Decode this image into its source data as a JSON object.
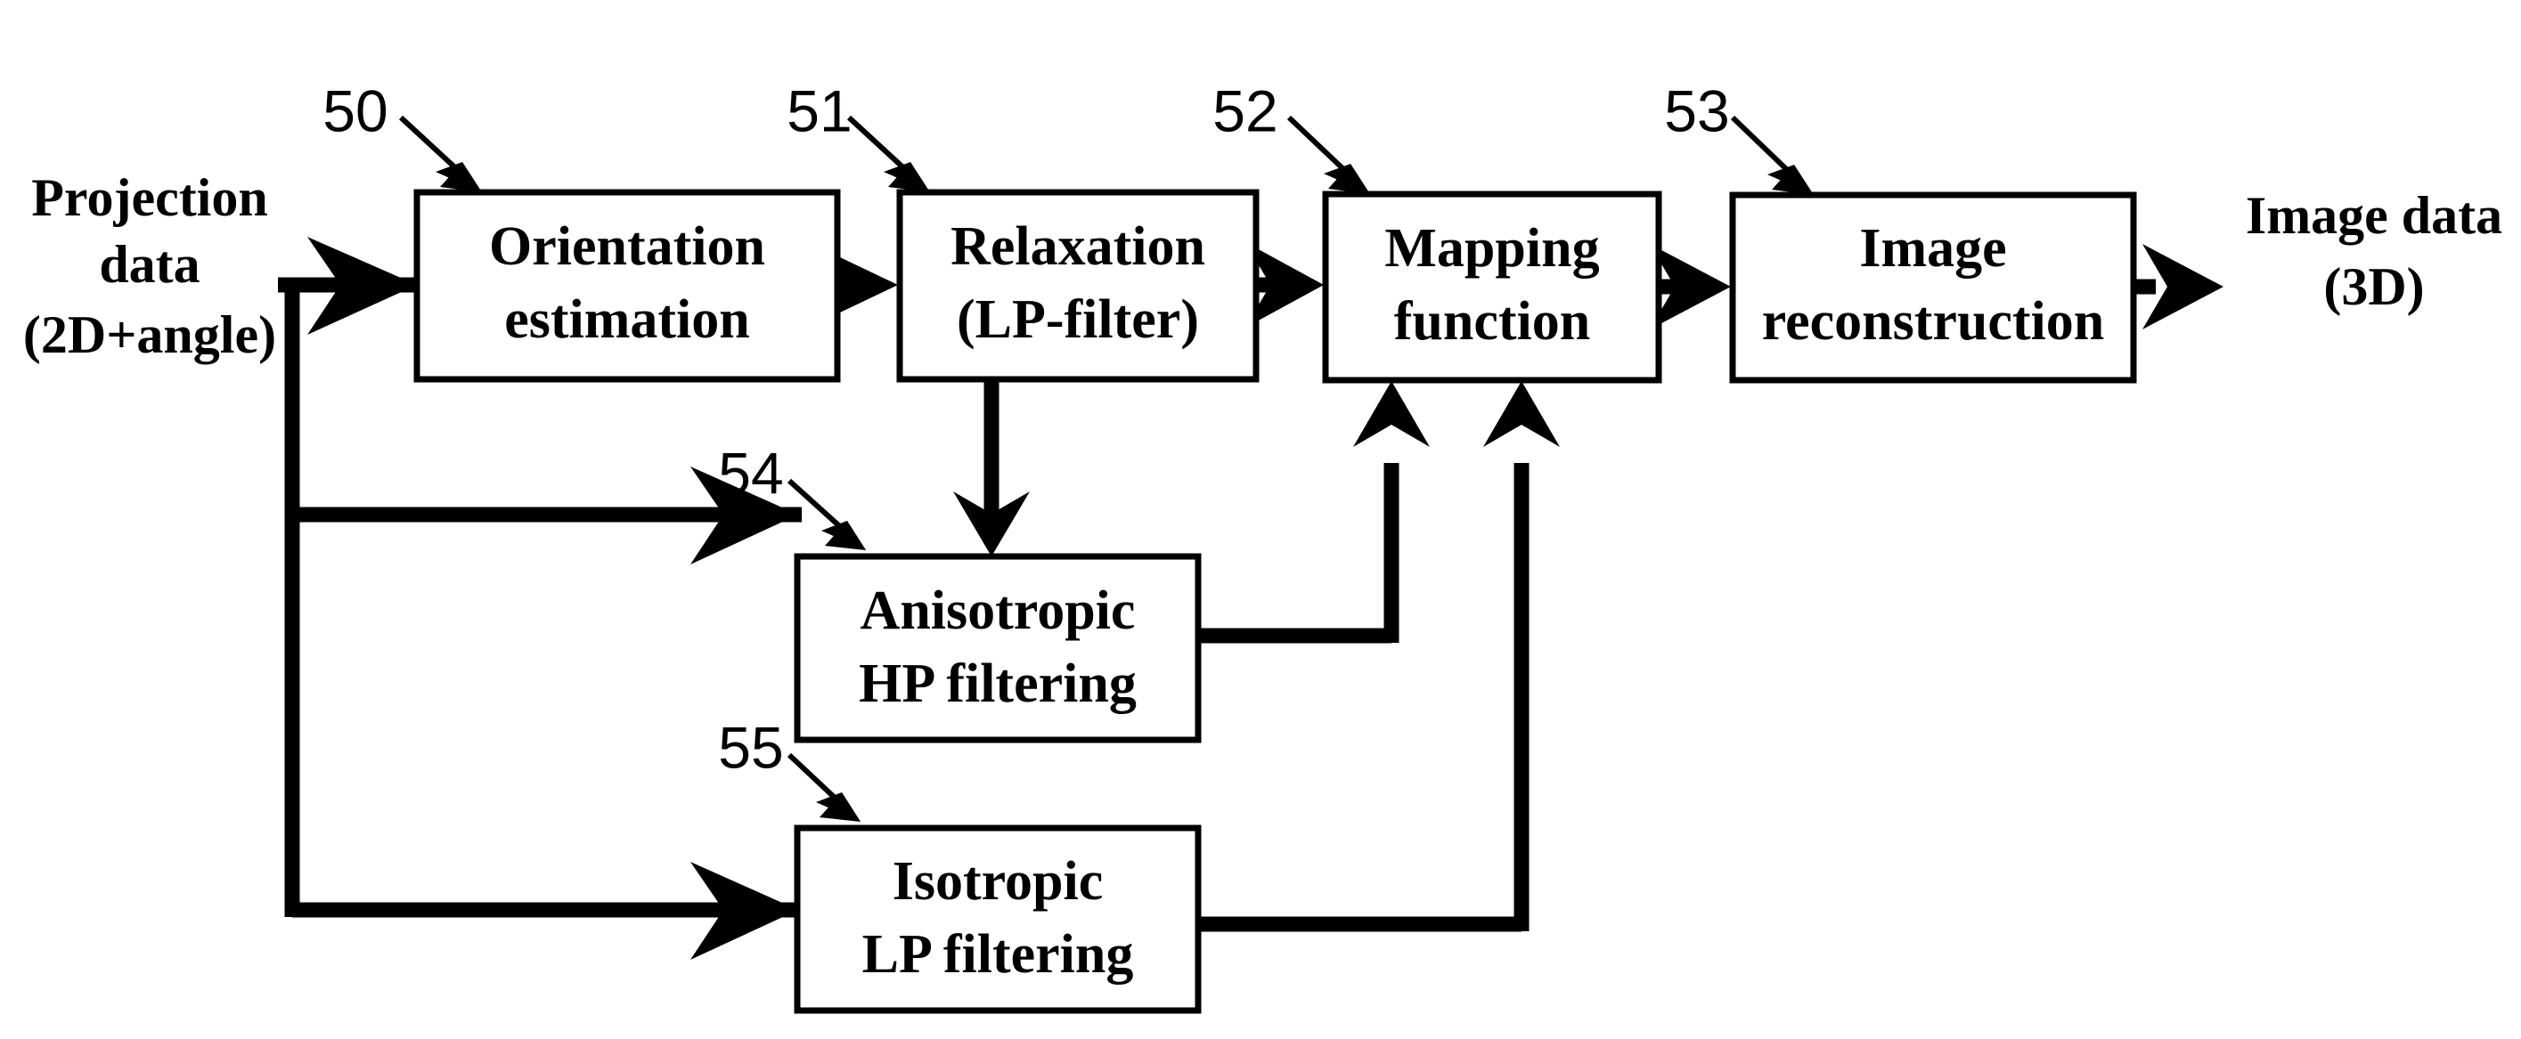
{
  "figure": {
    "title": "Image processing pipeline block diagram",
    "background_color": "#ffffff",
    "line_color": "#000000"
  },
  "io_labels": {
    "input": {
      "line1": "Projection",
      "line2": "data",
      "line3": "(2D+angle)"
    },
    "output": {
      "line1": "Image data",
      "line2": "(3D)"
    }
  },
  "blocks": [
    {
      "ref": "50",
      "line1": "Orientation",
      "line2": "estimation"
    },
    {
      "ref": "51",
      "line1": "Relaxation",
      "line2": "(LP-filter)"
    },
    {
      "ref": "52",
      "line1": "Mapping",
      "line2": "function"
    },
    {
      "ref": "53",
      "line1": "Image",
      "line2": "reconstruction"
    },
    {
      "ref": "54",
      "line1": "Anisotropic",
      "line2": "HP filtering"
    },
    {
      "ref": "55",
      "line1": "Isotropic",
      "line2": "LP filtering"
    }
  ],
  "connections": [
    {
      "name": "input-to-orientation",
      "from": "Projection data (2D+angle)",
      "to": "Orientation estimation"
    },
    {
      "name": "orientation-to-relaxation",
      "from": "Orientation estimation",
      "to": "Relaxation (LP-filter)"
    },
    {
      "name": "relaxation-to-mapping",
      "from": "Relaxation (LP-filter)",
      "to": "Mapping function"
    },
    {
      "name": "mapping-to-reconstruction",
      "from": "Mapping function",
      "to": "Image reconstruction"
    },
    {
      "name": "reconstruction-to-output",
      "from": "Image reconstruction",
      "to": "Image data (3D)"
    },
    {
      "name": "relaxation-to-anisotropic",
      "from": "Relaxation (LP-filter)",
      "to": "Anisotropic HP filtering"
    },
    {
      "name": "input-to-anisotropic",
      "from": "Projection data (2D+angle)",
      "to": "Anisotropic HP filtering"
    },
    {
      "name": "input-to-isotropic",
      "from": "Projection data (2D+angle)",
      "to": "Isotropic LP filtering"
    },
    {
      "name": "anisotropic-to-mapping",
      "from": "Anisotropic HP filtering",
      "to": "Mapping function"
    },
    {
      "name": "isotropic-to-mapping",
      "from": "Isotropic LP filtering",
      "to": "Mapping function"
    }
  ]
}
